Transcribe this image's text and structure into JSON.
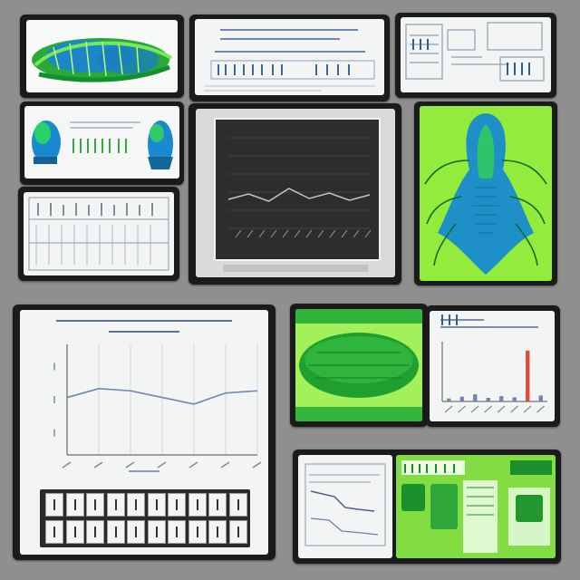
{
  "colors": {
    "background": "#8f8f8f",
    "panel_frame": "#1b1b1b",
    "panel_surface": "#f3f4f4",
    "accent_green": "#9bff2c",
    "dark_green": "#1f9f2d",
    "specimen_blue": "#1d86c9",
    "line_series": "#6f86b0",
    "dark_screen": "#2d2d2d"
  },
  "panels": {
    "a": {
      "kind": "specimen-image",
      "icon": "green-blue-organism-image"
    },
    "b": {
      "kind": "text-sheet"
    },
    "c": {
      "kind": "schematic-sheet"
    },
    "d": {
      "kind": "specimen-strip",
      "icons": [
        "blue-organism-icon",
        "blue-organism-icon"
      ]
    },
    "e": {
      "kind": "monitor",
      "chart_kind": "line"
    },
    "f": {
      "kind": "specimen-image",
      "icon": "blue-creature-image"
    },
    "g": {
      "kind": "sketch-sheet"
    },
    "h": {
      "kind": "line-chart"
    },
    "i": {
      "kind": "specimen-image",
      "icon": "green-leaf-image"
    },
    "j": {
      "kind": "bar-chart"
    },
    "k": {
      "kind": "sheet-pair"
    }
  },
  "chart_data": [
    {
      "type": "line",
      "values": [
        0.52,
        0.6,
        0.58,
        0.52,
        0.46,
        0.56,
        0.58
      ],
      "ylim": [
        0,
        1
      ],
      "grid": true
    },
    {
      "type": "line",
      "values": [
        0.32,
        0.38,
        0.3,
        0.44,
        0.33,
        0.39,
        0.31,
        0.37
      ],
      "ylim": [
        0,
        1
      ],
      "grid": true
    },
    {
      "type": "bar",
      "values": [
        0.05,
        0.08,
        0.12,
        0.06,
        0.09,
        0.07,
        0.85,
        0.1
      ],
      "ylim": [
        0,
        1
      ]
    }
  ]
}
